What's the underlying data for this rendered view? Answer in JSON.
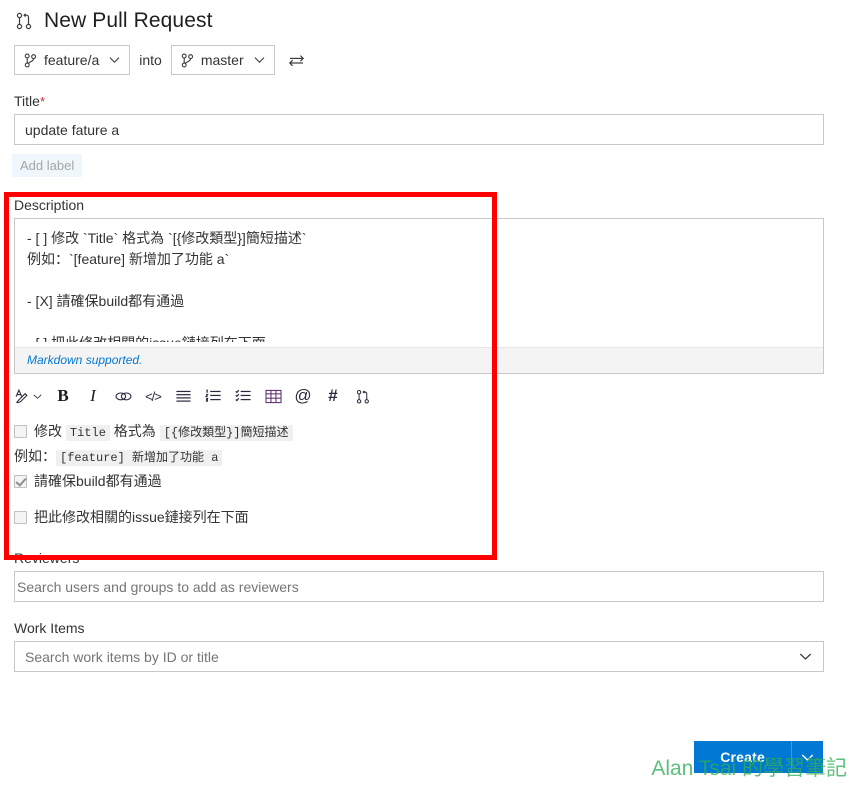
{
  "header": {
    "title": "New Pull Request",
    "icon": "pull-request-icon"
  },
  "branches": {
    "source": "feature/a",
    "into_label": "into",
    "target": "master",
    "swap_icon": "swap-arrows-icon",
    "branch_icon": "branch-icon",
    "chevron": "chevron-down-icon"
  },
  "title_field": {
    "label": "Title",
    "required_marker": "*",
    "value": "update fature a"
  },
  "add_label_button": {
    "label": "Add label"
  },
  "description": {
    "label": "Description",
    "markdown_value": "- [ ] 修改 `Title` 格式為 `[{修改類型}]簡短描述`\n例如：`[feature] 新增加了功能 a`\n\n- [X] 請確保build都有通過\n\n- [ ] 把此修改相關的issue鏈接列在下面",
    "markdown_note": "Markdown supported.",
    "toolbar": [
      {
        "name": "text-style-icon",
        "label": ""
      },
      {
        "name": "bold-icon",
        "label": "B"
      },
      {
        "name": "italic-icon",
        "label": "I"
      },
      {
        "name": "link-icon",
        "label": ""
      },
      {
        "name": "code-icon",
        "label": "</>"
      },
      {
        "name": "bullet-list-icon",
        "label": ""
      },
      {
        "name": "numbered-list-icon",
        "label": ""
      },
      {
        "name": "task-list-icon",
        "label": ""
      },
      {
        "name": "table-icon",
        "label": ""
      },
      {
        "name": "mention-icon",
        "label": "@"
      },
      {
        "name": "work-item-icon",
        "label": "#"
      },
      {
        "name": "pull-request-link-icon",
        "label": ""
      }
    ],
    "preview": {
      "items": [
        {
          "checked": false,
          "parts": [
            {
              "type": "text",
              "value": "修改 "
            },
            {
              "type": "code",
              "value": "Title"
            },
            {
              "type": "text",
              "value": " 格式為 "
            },
            {
              "type": "code",
              "value": "[{修改類型}]簡短描述"
            }
          ],
          "sub_parts": [
            {
              "type": "text",
              "value": "例如："
            },
            {
              "type": "code",
              "value": "[feature] 新增加了功能 a"
            }
          ]
        },
        {
          "checked": true,
          "parts": [
            {
              "type": "text",
              "value": "請確保build都有通過"
            }
          ],
          "sub_parts": []
        },
        {
          "checked": false,
          "parts": [
            {
              "type": "text",
              "value": "把此修改相關的issue鏈接列在下面"
            }
          ],
          "sub_parts": []
        }
      ]
    }
  },
  "reviewers": {
    "label": "Reviewers",
    "placeholder": "Search users and groups to add as reviewers",
    "value": ""
  },
  "work_items": {
    "label": "Work Items",
    "placeholder": "Search work items by ID or title",
    "value": "",
    "chevron": "chevron-down-icon"
  },
  "footer": {
    "create_label": "Create",
    "split_icon": "chevron-down-icon"
  },
  "watermark": {
    "text": "Alan Tsai 的學習筆記"
  },
  "annotation": {
    "color": "#fe0000"
  }
}
